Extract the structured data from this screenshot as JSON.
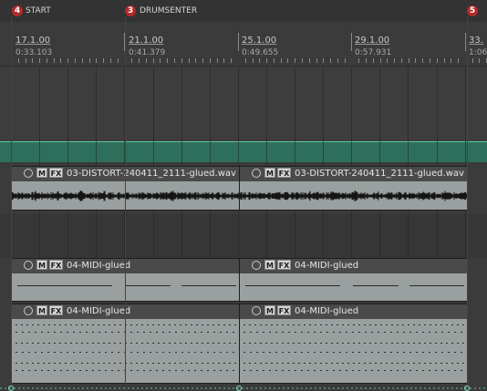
{
  "markers": [
    {
      "number": "4",
      "label": "START"
    },
    {
      "number": "3",
      "label": "DRUMSENTER"
    },
    {
      "number": "5",
      "label": ""
    }
  ],
  "ruler": [
    {
      "bar": "17.1.00",
      "time": "0:33.103"
    },
    {
      "bar": "21.1.00",
      "time": "0:41.379"
    },
    {
      "bar": "25.1.00",
      "time": "0:49.655"
    },
    {
      "bar": "29.1.00",
      "time": "0:57.931"
    },
    {
      "bar": "33.",
      "time": "1:06"
    }
  ],
  "items": {
    "audio_a": {
      "name": "03-DISTORT-240411_2111-glued.wav",
      "m": "M",
      "fx": "FX"
    },
    "audio_b": {
      "name": "03-DISTORT-240411_2111-glued.wav",
      "m": "M",
      "fx": "FX"
    },
    "midi1_a": {
      "name": "04-MIDI-glued",
      "m": "M",
      "fx": "FX"
    },
    "midi1_b": {
      "name": "04-MIDI-glued",
      "m": "M",
      "fx": "FX"
    },
    "midi2_a": {
      "name": "04-MIDI-glued",
      "m": "M",
      "fx": "FX"
    },
    "midi2_b": {
      "name": "04-MIDI-glued",
      "m": "M",
      "fx": "FX"
    }
  },
  "colors": {
    "marker": "#b22a2a",
    "selected_track": "#2e6f5c",
    "item_body": "#9aa09f"
  },
  "icons": [
    "lock-icon"
  ]
}
